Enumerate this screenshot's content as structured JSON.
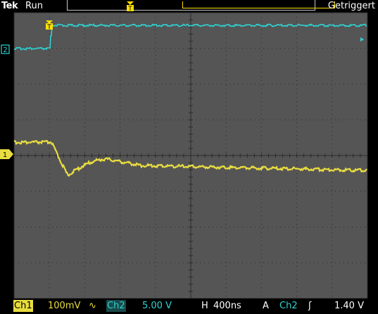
{
  "header": {
    "brand": "Tek",
    "run_state": "Run",
    "trigger_state": "Getriggert"
  },
  "markers": {
    "trigger_pos": "T",
    "ch1": "1",
    "ch2": "2"
  },
  "status": {
    "ch1_label": "Ch1",
    "ch1_scale": "100mV",
    "ch1_coupling": "∿",
    "ch2_label": "Ch2",
    "ch2_scale": "5.00 V",
    "horiz_label": "H",
    "horiz_scale": "400ns",
    "trig_mode": "A",
    "trig_source": "Ch2",
    "trig_slope": "ʃ",
    "trig_level": "1.40 V"
  },
  "colors": {
    "grid_bg": "#555555",
    "ch1": "#e8dc40",
    "ch2": "#2fd3d3"
  }
}
